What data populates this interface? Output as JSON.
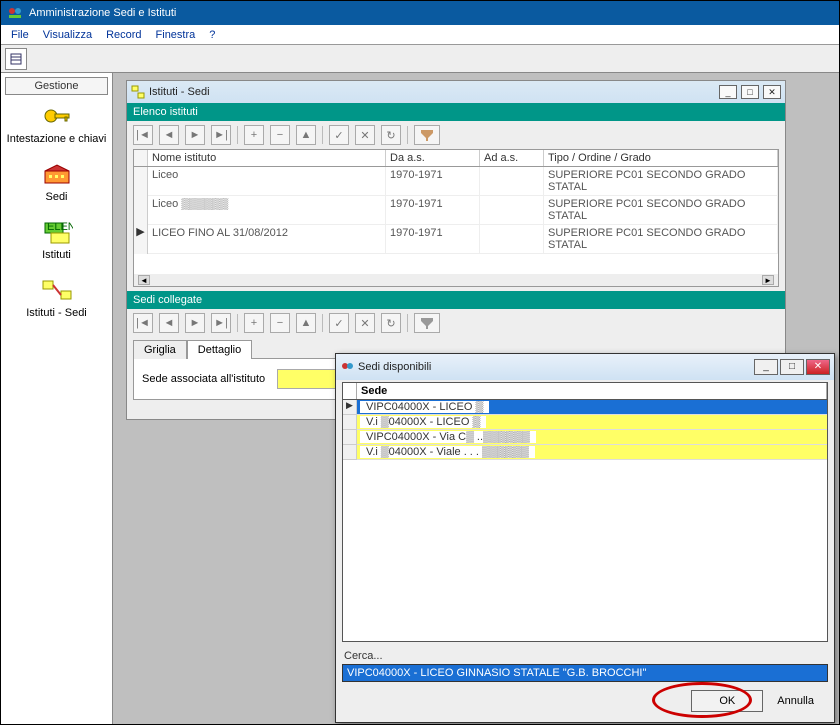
{
  "main_title": "Amministrazione Sedi e Istituti",
  "menu": {
    "file": "File",
    "visualizza": "Visualizza",
    "record": "Record",
    "finestra": "Finestra",
    "help": "?"
  },
  "sidebar": {
    "header": "Gestione",
    "items": [
      {
        "label": "Intestazione e chiavi"
      },
      {
        "label": "Sedi"
      },
      {
        "label": "Istituti"
      },
      {
        "label": "Istituti - Sedi"
      }
    ]
  },
  "child": {
    "title": "Istituti - Sedi",
    "section1": "Elenco istituti",
    "columns": {
      "nome": "Nome istituto",
      "da": "Da a.s.",
      "ad": "Ad a.s.",
      "tipo": "Tipo / Ordine / Grado"
    },
    "rows": [
      {
        "nome": "Liceo",
        "da": "1970-1971",
        "ad": "",
        "tipo": "SUPERIORE PC01 SECONDO GRADO STATAL"
      },
      {
        "nome": "Liceo ▒▒▒▒▒▒",
        "da": "1970-1971",
        "ad": "",
        "tipo": "SUPERIORE PC01 SECONDO GRADO STATAL"
      },
      {
        "nome": "LICEO FINO AL 31/08/2012",
        "da": "1970-1971",
        "ad": "",
        "tipo": "SUPERIORE PC01 SECONDO GRADO STATAL"
      }
    ],
    "section2": "Sedi collegate",
    "tabs": {
      "griglia": "Griglia",
      "dettaglio": "Dettaglio"
    },
    "form_label": "Sede associata all'istituto"
  },
  "dialog": {
    "title": "Sedi disponibili",
    "col": "Sede",
    "rows": [
      "VIPC04000X - LICEO ▒",
      "V.i ▒04000X - LICEO ▒",
      "VIPC04000X - Via C▒ ..▒▒▒▒▒▒",
      "V.i ▒04000X - Viale . . . ▒▒▒▒▒▒"
    ],
    "cerca_label": "Cerca...",
    "cerca_value": "VIPC04000X - LICEO GINNASIO STATALE \"G.B. BROCCHI\"",
    "ok": "OK",
    "annulla": "Annulla"
  }
}
